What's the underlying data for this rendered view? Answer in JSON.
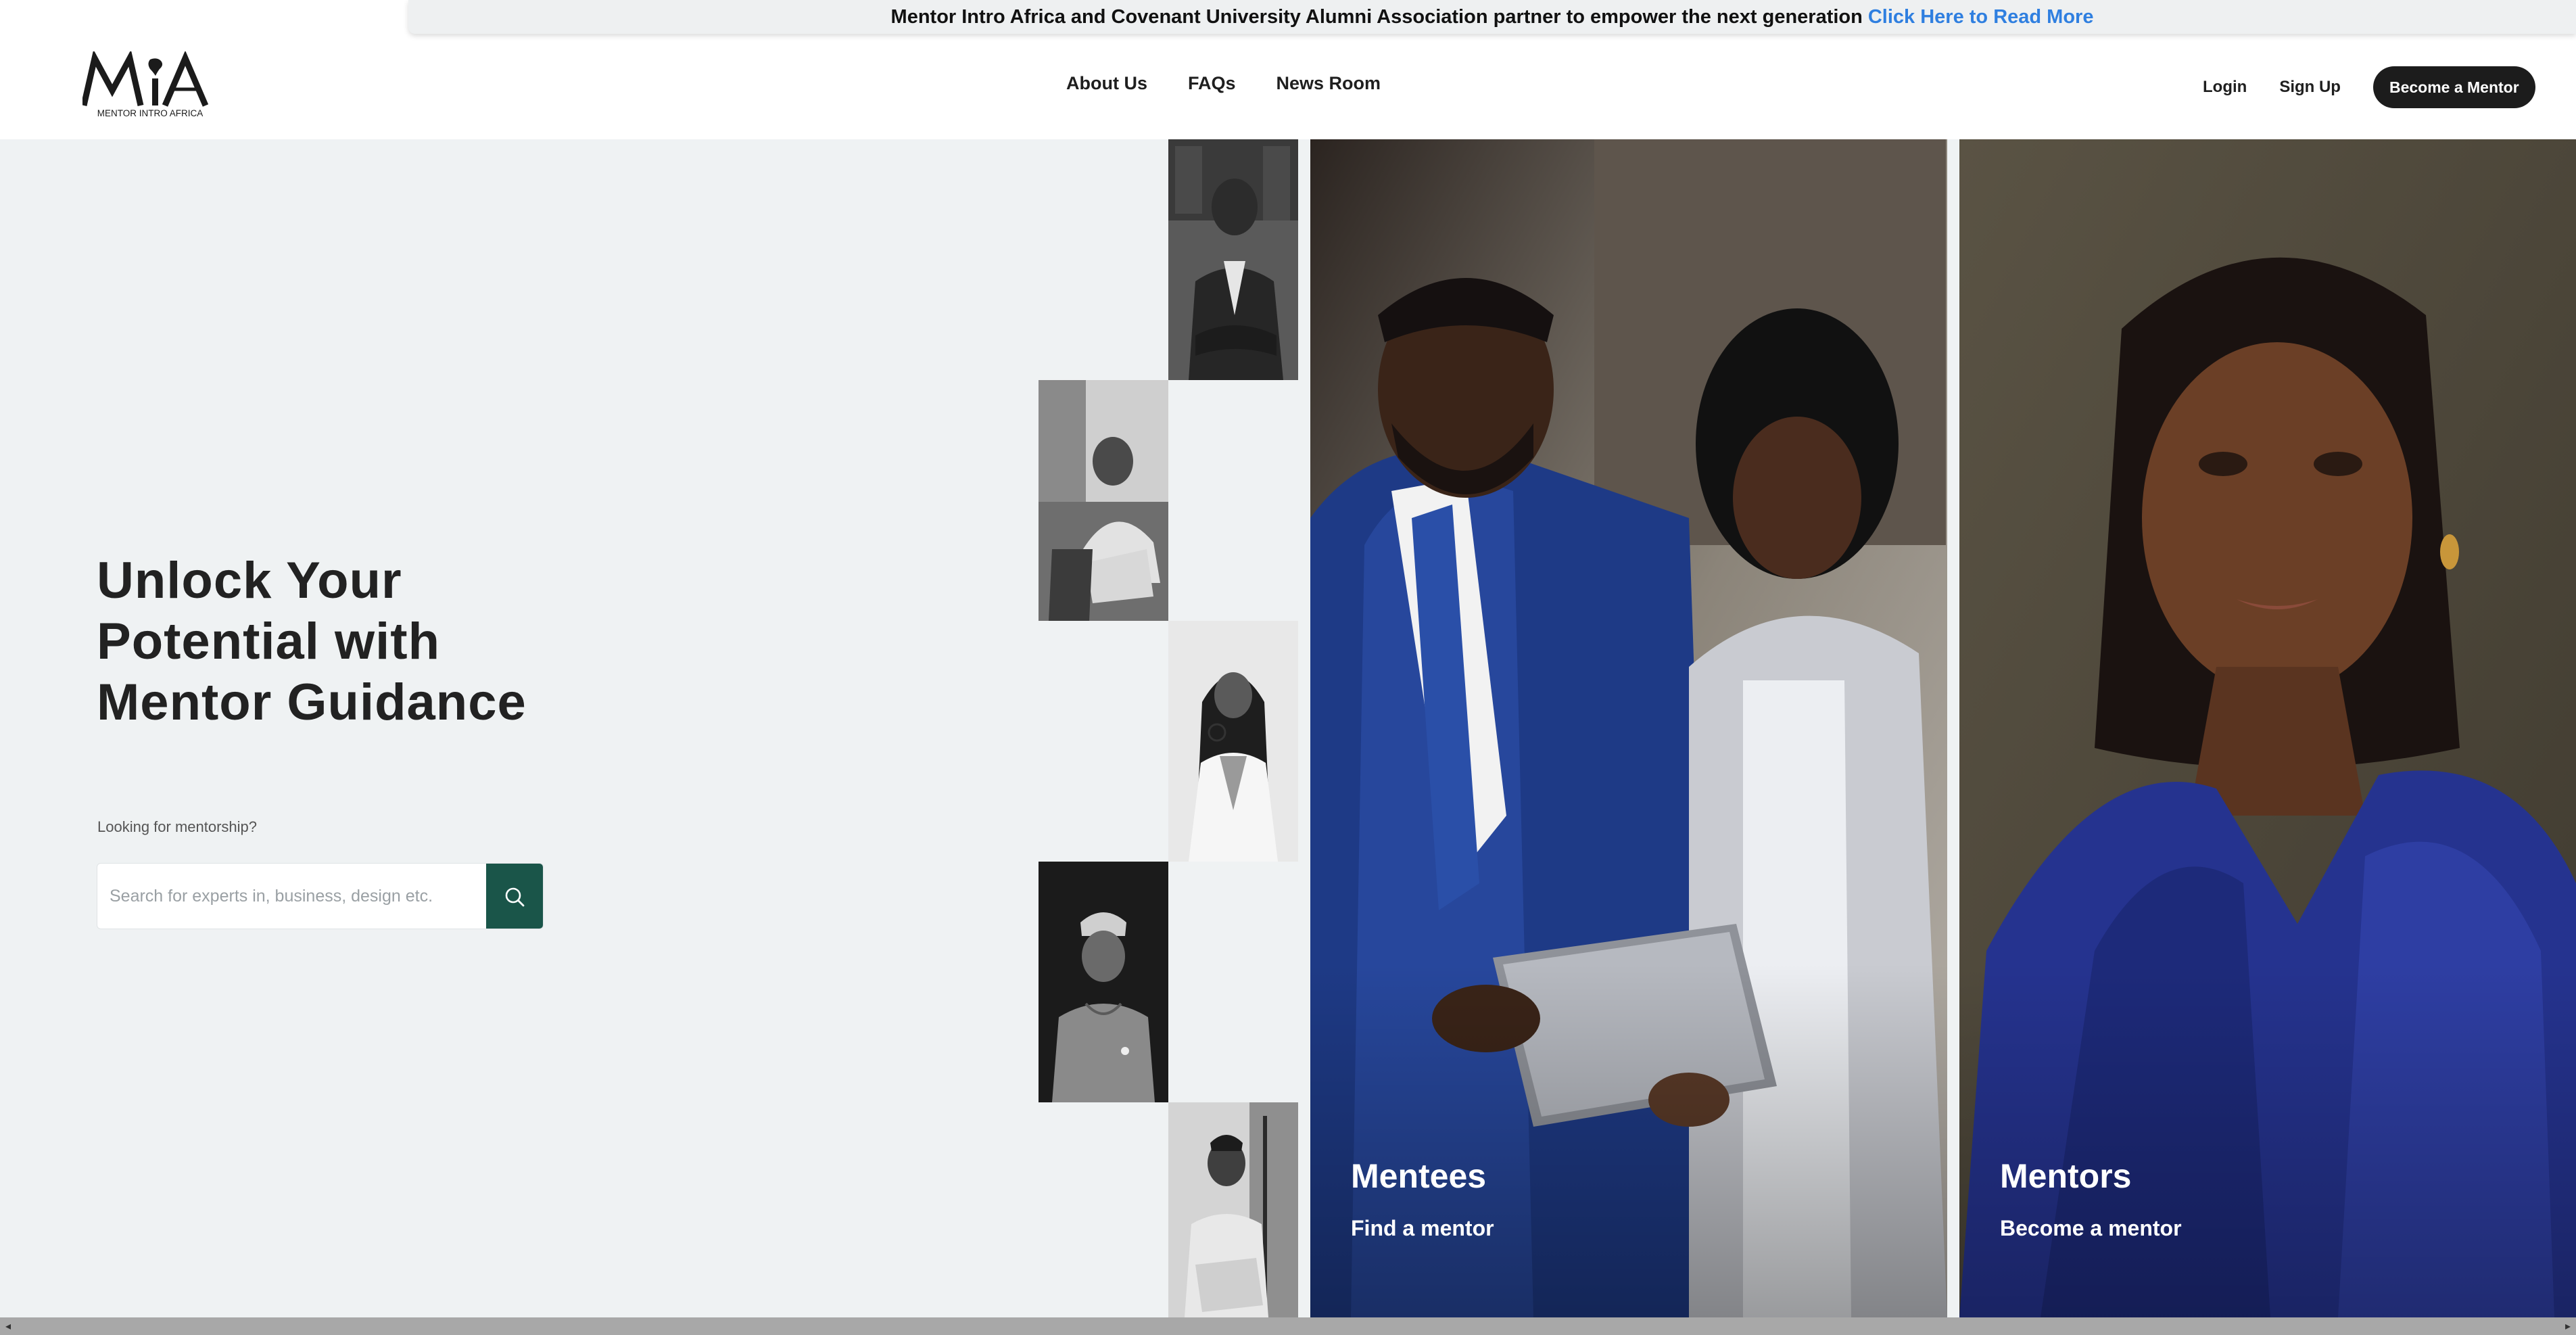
{
  "announcement": {
    "text": "Mentor Intro Africa and Covenant University Alumni Association partner to empower the next generation",
    "link": "Click Here to Read More"
  },
  "logo": {
    "mark": "MiA",
    "caption": "MENTOR INTRO AFRICA"
  },
  "nav": [
    "About Us",
    "FAQs",
    "News Room"
  ],
  "auth": {
    "login": "Login",
    "signup": "Sign Up",
    "cta": "Become a Mentor"
  },
  "hero": {
    "headline": "Unlock Your Potential with Mentor Guidance",
    "subtitle": "Looking for mentorship?",
    "search_placeholder": "Search for experts in, business, design etc."
  },
  "cards": [
    {
      "title": "Mentees",
      "subtitle": "Find a mentor"
    },
    {
      "title": "Mentors",
      "subtitle": "Become a mentor"
    }
  ],
  "icons": {
    "search": "search-icon",
    "scroll_left": "chevron-left-icon",
    "scroll_right": "chevron-right-icon"
  },
  "colors": {
    "search_button": "#1a5549",
    "link": "#2f7fe0",
    "hero_bg": "#eff2f3",
    "cta_bg": "#1c1c1c"
  }
}
